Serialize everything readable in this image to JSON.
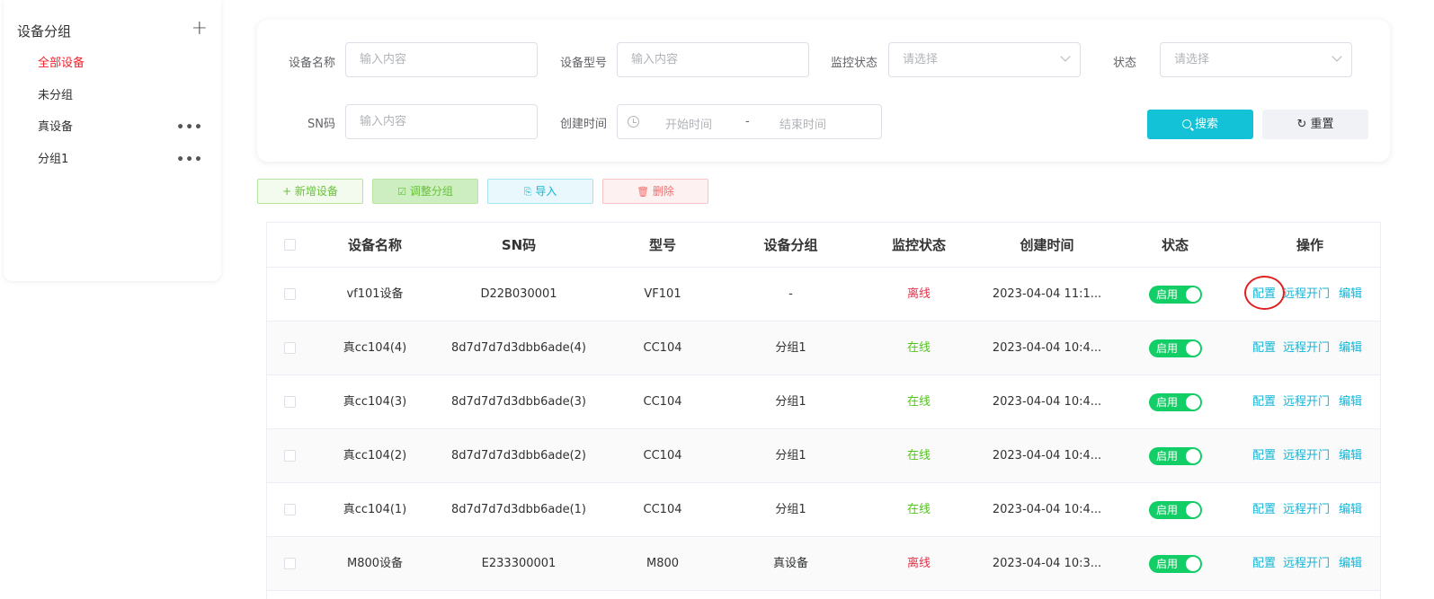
{
  "sidebar": {
    "title": "设备分组",
    "add_icon": "+",
    "more_icon": "•••",
    "items": [
      {
        "label": "全部设备",
        "active": true
      },
      {
        "label": "未分组"
      },
      {
        "label": "真设备",
        "has_more": true
      },
      {
        "label": "分组1",
        "has_more": true
      }
    ]
  },
  "filter": {
    "device_name_label": "设备名称",
    "device_name_placeholder": "输入内容",
    "device_model_label": "设备型号",
    "device_model_placeholder": "输入内容",
    "monitor_status_label": "监控状态",
    "monitor_status_placeholder": "请选择",
    "status_label": "状态",
    "status_placeholder": "请选择",
    "sn_label": "SN码",
    "sn_placeholder": "输入内容",
    "created_label": "创建时间",
    "start_placeholder": "开始时间",
    "range_sep": "-",
    "end_placeholder": "结束时间",
    "search_label": "搜索",
    "reset_label": "重置"
  },
  "actions": {
    "add": "+ 新增设备",
    "group": "调整分组",
    "import": "导入",
    "delete": "删除"
  },
  "table": {
    "headers": [
      "设备名称",
      "SN码",
      "型号",
      "设备分组",
      "监控状态",
      "创建时间",
      "状态",
      "操作"
    ],
    "rows": [
      {
        "name": "vf101设备",
        "sn": "D22B030001",
        "model": "VF101",
        "group": "-",
        "monitor": "离线",
        "created": "2023-04-04 11:1...",
        "status": "启用",
        "op1": "配置",
        "op2": "远程开门",
        "op3": "编辑"
      },
      {
        "name": "真cc104(4)",
        "sn": "8d7d7d7d3dbb6ade(4)",
        "model": "CC104",
        "group": "分组1",
        "monitor": "在线",
        "created": "2023-04-04 10:4...",
        "status": "启用",
        "op1": "配置",
        "op2": "远程开门",
        "op3": "编辑"
      },
      {
        "name": "真cc104(3)",
        "sn": "8d7d7d7d3dbb6ade(3)",
        "model": "CC104",
        "group": "分组1",
        "monitor": "在线",
        "created": "2023-04-04 10:4...",
        "status": "启用",
        "op1": "配置",
        "op2": "远程开门",
        "op3": "编辑"
      },
      {
        "name": "真cc104(2)",
        "sn": "8d7d7d7d3dbb6ade(2)",
        "model": "CC104",
        "group": "分组1",
        "monitor": "在线",
        "created": "2023-04-04 10:4...",
        "status": "启用",
        "op1": "配置",
        "op2": "远程开门",
        "op3": "编辑"
      },
      {
        "name": "真cc104(1)",
        "sn": "8d7d7d7d3dbb6ade(1)",
        "model": "CC104",
        "group": "分组1",
        "monitor": "在线",
        "created": "2023-04-04 10:4...",
        "status": "启用",
        "op1": "配置",
        "op2": "远程开门",
        "op3": "编辑"
      },
      {
        "name": "M800设备",
        "sn": "E233300001",
        "model": "M800",
        "group": "真设备",
        "monitor": "离线",
        "created": "2023-04-04 10:3...",
        "status": "启用",
        "op1": "配置",
        "op2": "远程开门",
        "op3": "编辑"
      }
    ]
  },
  "colors": {
    "accent": "#13c2d6",
    "online": "#52c41a",
    "offline": "#e5324a",
    "switch_on": "#13ce66",
    "active_nav": "#f5222d"
  }
}
